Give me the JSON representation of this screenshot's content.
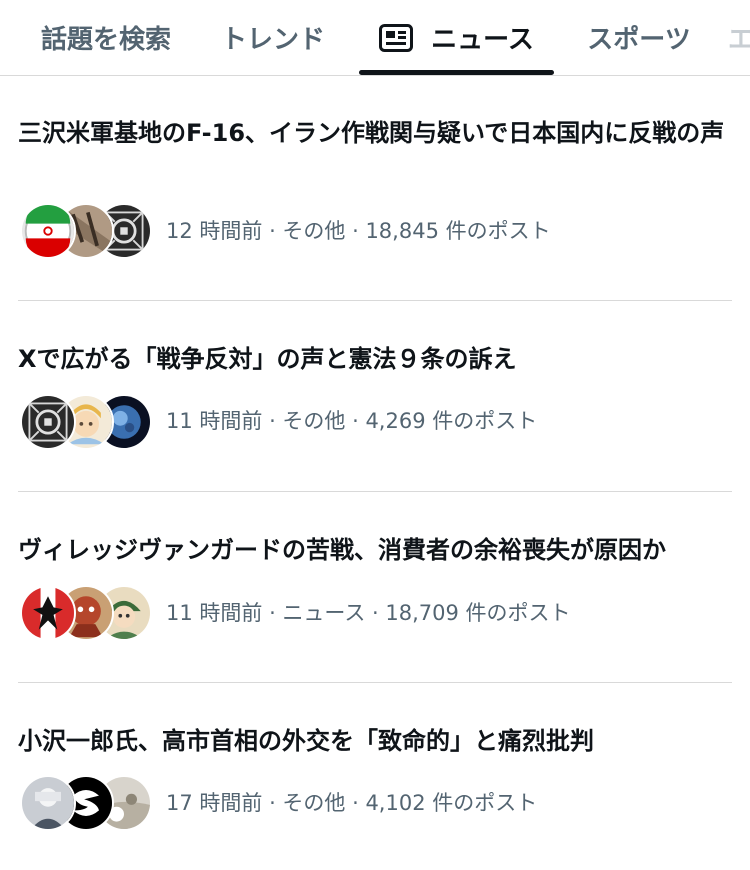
{
  "tabs": [
    {
      "label": "話題を検索"
    },
    {
      "label": "トレンド"
    },
    {
      "label": "ニュース",
      "icon": "news-icon",
      "active": true
    },
    {
      "label": "スポーツ"
    },
    {
      "label": "エ"
    }
  ],
  "items": [
    {
      "headline": "三沢米軍基地のF-16、イラン作戦関与疑いで日本国内に反戦の声",
      "meta": "12 時間前 · その他 · 18,845 件のポスト"
    },
    {
      "headline": "Xで広がる「戦争反対」の声と憲法９条の訴え",
      "meta": "11 時間前 · その他 · 4,269 件のポスト"
    },
    {
      "headline": "ヴィレッジヴァンガードの苦戦、消費者の余裕喪失が原因か",
      "meta": "11 時間前 · ニュース · 18,709 件のポスト"
    },
    {
      "headline": "小沢一郎氏、高市首相の外交を「致命的」と痛烈批判",
      "meta": "17 時間前 · その他 · 4,102 件のポスト"
    }
  ]
}
